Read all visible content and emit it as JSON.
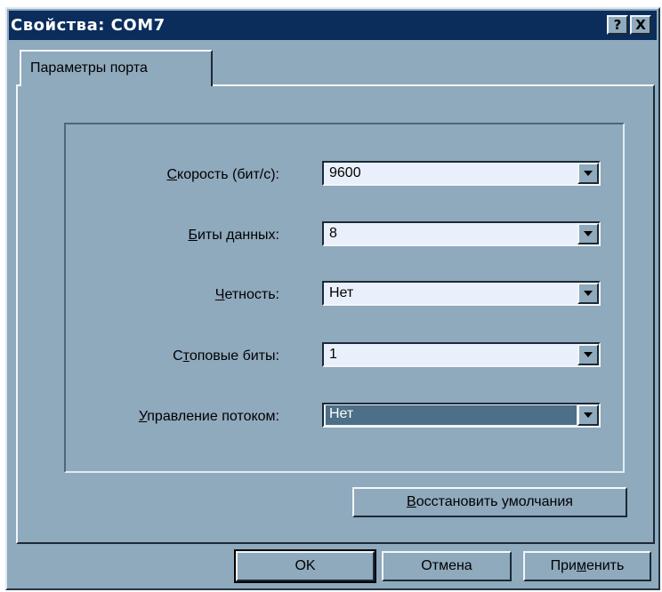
{
  "window": {
    "title": "Свойства: COM7",
    "help_button": "?",
    "close_button": "X"
  },
  "tabs": [
    {
      "label": "Параметры порта",
      "active": true
    }
  ],
  "fields": [
    {
      "label_access": "С",
      "label_rest": "корость (бит/с):",
      "value": "9600"
    },
    {
      "label_access": "Б",
      "label_rest": "иты данных:",
      "value": "8"
    },
    {
      "label_access": "Ч",
      "label_rest": "етность:",
      "value": "Нет"
    },
    {
      "label_pre": "С",
      "label_access": "т",
      "label_rest": "оповые биты:",
      "value": "1"
    },
    {
      "label_access": "У",
      "label_rest": "правление потоком:",
      "value": "Нет",
      "selected": true
    }
  ],
  "restore_button": {
    "access": "В",
    "rest": "осстановить умолчания"
  },
  "buttons": {
    "ok": "OK",
    "cancel": "Отмена",
    "apply_pre": "При",
    "apply_access": "м",
    "apply_rest": "енить"
  },
  "colors": {
    "titlebar": "#0b2d5c",
    "face": "#8fa9bd",
    "field_bg": "#eaf0fb",
    "selection": "#4d6f87"
  }
}
